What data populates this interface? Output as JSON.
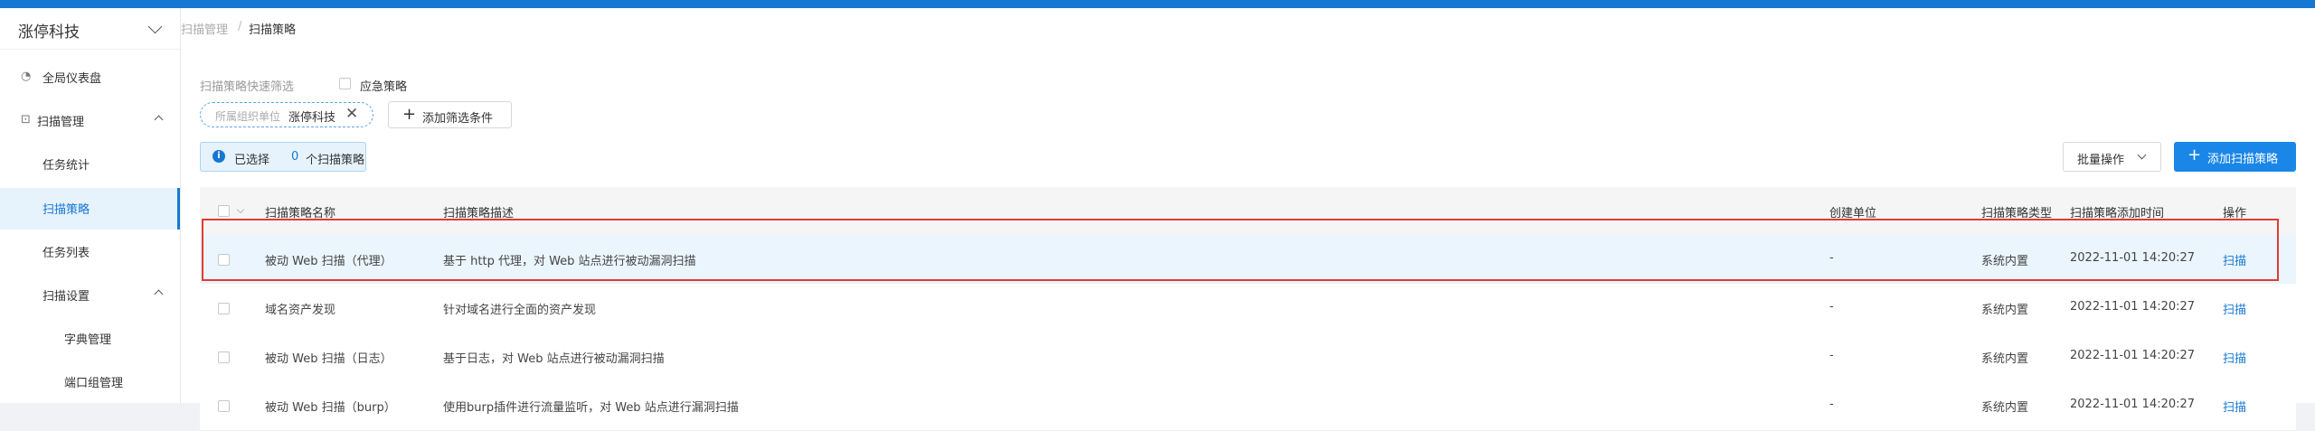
{
  "sidebar": {
    "org_name": "涨停科技",
    "items": [
      {
        "label": "全局仪表盘",
        "icon": "dashboard-icon",
        "glyph": "◔"
      },
      {
        "label": "扫描管理",
        "icon": "scan-icon",
        "glyph": "⊡"
      },
      {
        "label": "任务统计"
      },
      {
        "label": "扫描策略"
      },
      {
        "label": "任务列表"
      },
      {
        "label": "扫描设置"
      },
      {
        "label": "字典管理"
      },
      {
        "label": "端口组管理"
      }
    ]
  },
  "breadcrumb": {
    "parent": "扫描管理",
    "separator": "/",
    "current": "扫描策略"
  },
  "filters": {
    "quick_label": "扫描策略快速筛选",
    "urgent_label": "应急策略",
    "chip_key": "所属组织单位",
    "chip_value": "涨停科技",
    "chip_close": "✕",
    "add_filter_plus": "+",
    "add_filter_label": "添加筛选条件"
  },
  "selection": {
    "icon": "i",
    "prefix": "已选择",
    "count": "0",
    "suffix": "个扫描策略"
  },
  "toolbar": {
    "batch_label": "批量操作",
    "add_plus": "+",
    "add_label": "添加扫描策略"
  },
  "table": {
    "headers": [
      "扫描策略名称",
      "扫描策略描述",
      "创建单位",
      "扫描策略类型",
      "扫描策略添加时间",
      "操作"
    ],
    "rows": [
      {
        "name": "被动 Web 扫描（代理）",
        "desc": "基于 http 代理，对 Web 站点进行被动漏洞扫描",
        "unit": "-",
        "type": "系统内置",
        "time": "2022-11-01 14:20:27",
        "action": "扫描"
      },
      {
        "name": "域名资产发现",
        "desc": "针对域名进行全面的资产发现",
        "unit": "-",
        "type": "系统内置",
        "time": "2022-11-01 14:20:27",
        "action": "扫描"
      },
      {
        "name": "被动 Web 扫描（日志）",
        "desc": "基于日志，对 Web 站点进行被动漏洞扫描",
        "unit": "-",
        "type": "系统内置",
        "time": "2022-11-01 14:20:27",
        "action": "扫描"
      },
      {
        "name": "被动 Web 扫描（burp）",
        "desc": "使用burp插件进行流量监听，对 Web 站点进行漏洞扫描",
        "unit": "-",
        "type": "系统内置",
        "time": "2022-11-01 14:20:27",
        "action": "扫描"
      }
    ]
  }
}
